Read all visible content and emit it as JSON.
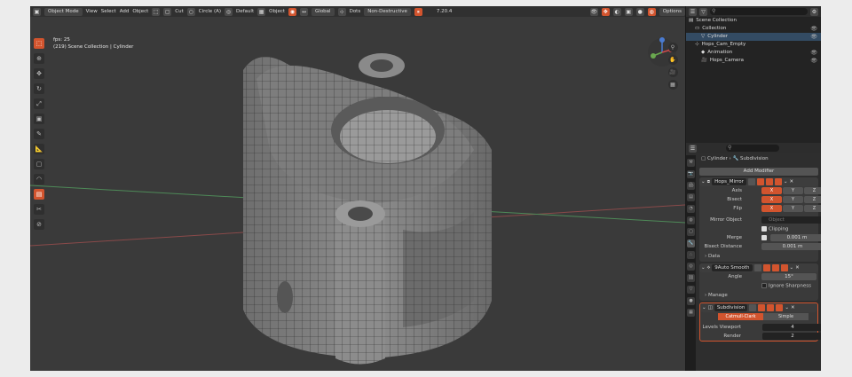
{
  "header": {
    "mode": "Object Mode",
    "menu": [
      "View",
      "Select",
      "Add",
      "Object"
    ],
    "select_box": "Cut",
    "circle": "Circle (A)",
    "pivot": "Default",
    "object_toggle": "Object",
    "orientation": "Global",
    "snap": "Dots",
    "nondestructive": "Non-Destructive",
    "zoom_value": "7.20.4",
    "options": "Options"
  },
  "viewport": {
    "fps": "fps: 25",
    "collection": "(219) Scene Collection | Cylinder"
  },
  "tools": [
    "select-tool",
    "cursor-tool",
    "move-tool",
    "rotate-tool",
    "scale-tool",
    "transform-tool",
    "annotate-tool",
    "measure-tool",
    "add-cube-tool",
    "shear-tool",
    "boxcutter-tool",
    "hardops-tool",
    "knife-tool",
    "spin-tool"
  ],
  "outliner": {
    "search": "",
    "rows": [
      {
        "label": "Scene Collection",
        "indent": 0,
        "icon": "scene-collection-icon"
      },
      {
        "label": "Collection",
        "indent": 1,
        "icon": "collection-icon"
      },
      {
        "label": "Cylinder",
        "indent": 2,
        "icon": "mesh-icon"
      },
      {
        "label": "Hops_Cam_Empty",
        "indent": 1,
        "icon": "empty-icon"
      },
      {
        "label": "Animation",
        "indent": 2,
        "icon": "animation-icon"
      },
      {
        "label": "Hops_Camera",
        "indent": 2,
        "icon": "camera-icon"
      }
    ]
  },
  "properties": {
    "search": "",
    "breadcrumb_object": "Cylinder",
    "breadcrumb_modifier": "Subdivision",
    "add_modifier": "Add Modifier",
    "mirror": {
      "name": "Hops_Mirror",
      "axis_label": "Axis",
      "bisect_label": "Bisect",
      "flip_label": "Flip",
      "x": "X",
      "y": "Y",
      "z": "Z",
      "mirror_object_label": "Mirror Object",
      "mirror_object_placeholder": "Object",
      "clipping": "Clipping",
      "merge_label": "Merge",
      "merge_value": "0.001 m",
      "bisect_distance_label": "Bisect Distance",
      "bisect_distance_value": "0.001 m",
      "data_section": "Data"
    },
    "autosmooth": {
      "name": "9Auto Smooth",
      "angle_label": "Angle",
      "angle_value": "15°",
      "ignore_sharpness": "Ignore Sharpness",
      "manage_section": "Manage"
    },
    "subdivision": {
      "name": "Subdivision",
      "catmull": "Catmull-Clark",
      "simple": "Simple",
      "levels_viewport_label": "Levels Viewport",
      "levels_viewport_value": "4",
      "render_label": "Render",
      "render_value": "2"
    }
  },
  "colors": {
    "accent": "#d2542e",
    "viewport_bg": "#3a3a3a",
    "grid_green": "#4e8a58",
    "grid_red": "#8a4a4a"
  }
}
